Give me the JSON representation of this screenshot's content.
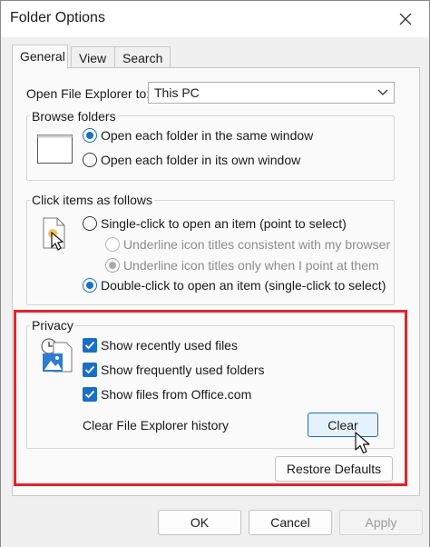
{
  "window": {
    "title": "Folder Options"
  },
  "tabs": [
    {
      "label": "General",
      "active": true
    },
    {
      "label": "View",
      "active": false
    },
    {
      "label": "Search",
      "active": false
    }
  ],
  "open_explorer": {
    "label": "Open File Explorer to:",
    "value": "This PC"
  },
  "browse_folders": {
    "title": "Browse folders",
    "options": [
      {
        "label": "Open each folder in the same window",
        "checked": true
      },
      {
        "label": "Open each folder in its own window",
        "checked": false
      }
    ]
  },
  "click_items": {
    "title": "Click items as follows",
    "single_click": "Single-click to open an item (point to select)",
    "underline_browser": "Underline icon titles consistent with my browser",
    "underline_point": "Underline icon titles only when I point at them",
    "double_click": "Double-click to open an item (single-click to select)"
  },
  "privacy": {
    "title": "Privacy",
    "checkboxes": [
      {
        "label": "Show recently used files",
        "checked": true
      },
      {
        "label": "Show frequently used folders",
        "checked": true
      },
      {
        "label": "Show files from Office.com",
        "checked": true
      }
    ],
    "clear_history_label": "Clear File Explorer history",
    "clear_button": "Clear"
  },
  "restore_defaults": "Restore Defaults",
  "footer": {
    "ok": "OK",
    "cancel": "Cancel",
    "apply": "Apply"
  },
  "colors": {
    "accent": "#1a6fc4",
    "highlight": "#e3242b"
  }
}
